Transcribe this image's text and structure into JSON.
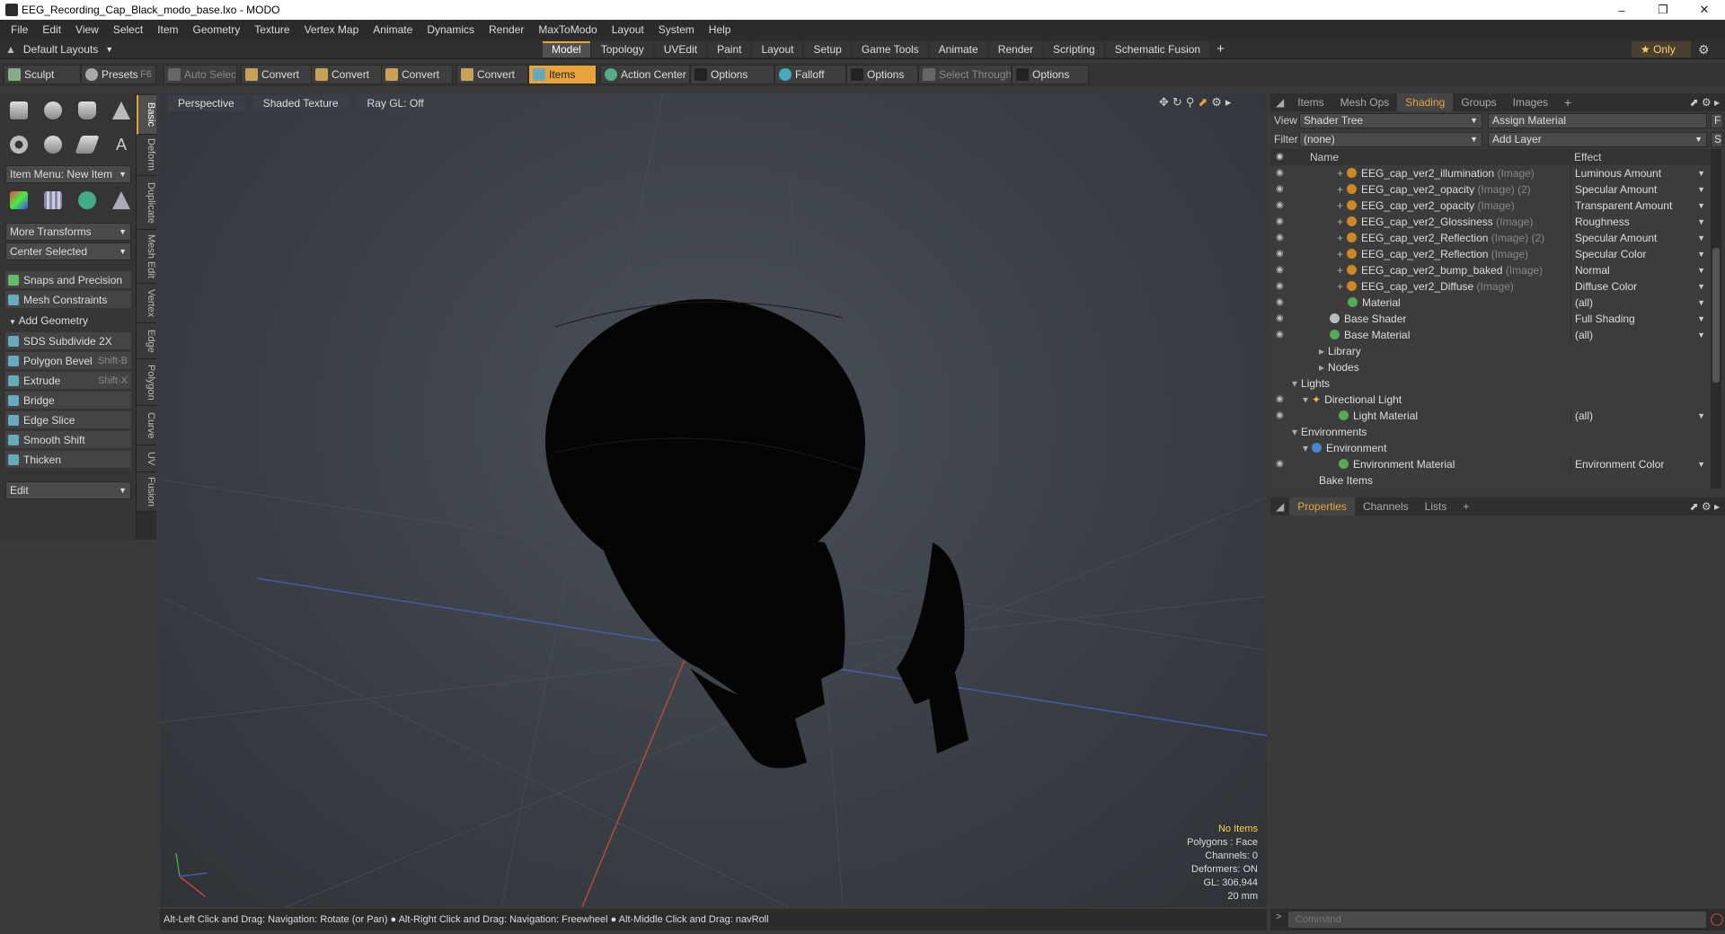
{
  "window": {
    "title": "EEG_Recording_Cap_Black_modo_base.lxo - MODO"
  },
  "menu": [
    "File",
    "Edit",
    "View",
    "Select",
    "Item",
    "Geometry",
    "Texture",
    "Vertex Map",
    "Animate",
    "Dynamics",
    "Render",
    "MaxToModo",
    "Layout",
    "System",
    "Help"
  ],
  "layouts": {
    "label": "Default Layouts"
  },
  "layout_tabs": [
    "Model",
    "Topology",
    "UVEdit",
    "Paint",
    "Layout",
    "Setup",
    "Game Tools",
    "Animate",
    "Render",
    "Scripting",
    "Schematic Fusion"
  ],
  "only_label": "Only",
  "toolbar": {
    "sculpt": "Sculpt",
    "presets": "Presets",
    "presets_key": "F6",
    "auto_select": "Auto Select",
    "convert1": "Convert",
    "convert2": "Convert",
    "convert3": "Convert",
    "convert4": "Convert",
    "items": "Items",
    "action_center": "Action Center",
    "options1": "Options",
    "falloff": "Falloff",
    "options2": "Options",
    "select_through": "Select Through",
    "options3": "Options"
  },
  "left": {
    "item_menu": "Item Menu: New Item",
    "more_transforms": "More Transforms",
    "center_selected": "Center Selected",
    "snaps": "Snaps and Precision",
    "mesh_constraints": "Mesh Constraints",
    "add_geometry": "Add Geometry",
    "tools": [
      {
        "label": "SDS Subdivide 2X",
        "key": ""
      },
      {
        "label": "Polygon Bevel",
        "key": "Shift-B"
      },
      {
        "label": "Extrude",
        "key": "Shift-X"
      },
      {
        "label": "Bridge",
        "key": ""
      },
      {
        "label": "Edge Slice",
        "key": ""
      },
      {
        "label": "Smooth Shift",
        "key": ""
      },
      {
        "label": "Thicken",
        "key": ""
      }
    ],
    "edit": "Edit",
    "vtabs": [
      "Basic",
      "Deform",
      "Duplicate",
      "Mesh Edit",
      "Vertex",
      "Edge",
      "Polygon",
      "Curve",
      "UV",
      "Fusion"
    ]
  },
  "viewport": {
    "perspective": "Perspective",
    "shading": "Shaded Texture",
    "raygl": "Ray GL: Off",
    "info": {
      "no_items": "No Items",
      "polygons": "Polygons : Face",
      "channels": "Channels: 0",
      "deformers": "Deformers: ON",
      "gl": "GL: 306,944",
      "scale": "20 mm"
    }
  },
  "status": "Alt-Left Click and Drag: Navigation: Rotate (or Pan) ● Alt-Right Click and Drag: Navigation: Freewheel ● Alt-Middle Click and Drag: navRoll",
  "right": {
    "tabs": [
      "Items",
      "Mesh Ops",
      "Shading",
      "Groups",
      "Images"
    ],
    "view_label": "View",
    "view_value": "Shader Tree",
    "assign": "Assign Material",
    "f": "F",
    "filter_label": "Filter",
    "filter_value": "(none)",
    "add_layer": "Add Layer",
    "s": "S",
    "col_name": "Name",
    "col_effect": "Effect",
    "rows": [
      {
        "name": "EEG_cap_ver2_illumination",
        "tag": "(Image)",
        "effect": "Luminous Amount"
      },
      {
        "name": "EEG_cap_ver2_opacity",
        "tag": "(Image) (2)",
        "effect": "Specular Amount"
      },
      {
        "name": "EEG_cap_ver2_opacity",
        "tag": "(Image)",
        "effect": "Transparent Amount"
      },
      {
        "name": "EEG_cap_ver2_Glossiness",
        "tag": "(Image)",
        "effect": "Roughness"
      },
      {
        "name": "EEG_cap_ver2_Reflection",
        "tag": "(Image) (2)",
        "effect": "Specular Amount"
      },
      {
        "name": "EEG_cap_ver2_Reflection",
        "tag": "(Image)",
        "effect": "Specular Color"
      },
      {
        "name": "EEG_cap_ver2_bump_baked",
        "tag": "(Image)",
        "effect": "Normal"
      },
      {
        "name": "EEG_cap_ver2_Diffuse",
        "tag": "(Image)",
        "effect": "Diffuse Color"
      }
    ],
    "material": "Material",
    "material_eff": "(all)",
    "base_shader": "Base Shader",
    "base_shader_eff": "Full Shading",
    "base_material": "Base Material",
    "base_material_eff": "(all)",
    "library": "Library",
    "nodes": "Nodes",
    "lights": "Lights",
    "dir_light": "Directional Light",
    "light_material": "Light Material",
    "light_material_eff": "(all)",
    "environments": "Environments",
    "environment": "Environment",
    "env_material": "Environment Material",
    "env_material_eff": "Environment Color",
    "bake_items": "Bake Items",
    "prop_tabs": [
      "Properties",
      "Channels",
      "Lists"
    ],
    "command_placeholder": "Command"
  }
}
